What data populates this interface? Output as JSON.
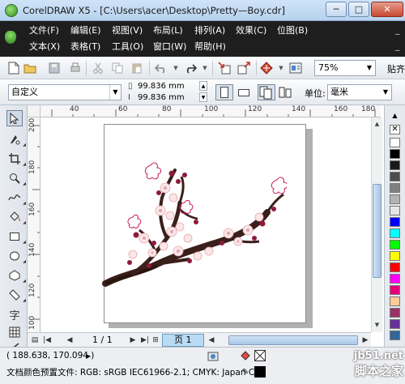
{
  "window": {
    "title": "CorelDRAW X5 - [C:\\Users\\acer\\Desktop\\Pretty—Boy.cdr]",
    "min_glyph": "─",
    "max_glyph": "□",
    "close_glyph": "✕"
  },
  "menubar": {
    "row1": [
      "文件(F)",
      "编辑(E)",
      "视图(V)",
      "布局(L)",
      "排列(A)",
      "效果(C)",
      "位图(B)"
    ],
    "row2": [
      "文本(X)",
      "表格(T)",
      "工具(O)",
      "窗口(W)",
      "帮助(H)"
    ],
    "row1_trailing": "_",
    "row2_trailing": "_"
  },
  "toolbar": {
    "zoom_value": "75%",
    "right_label": "贴齐",
    "icons": [
      "new-file-icon",
      "open-icon",
      "save-icon",
      "cut-icon",
      "copy-icon",
      "paste-icon",
      "undo-icon",
      "redo-icon",
      "import-icon",
      "export-icon",
      "application-launcher-icon",
      "welcome-screen-icon"
    ]
  },
  "property_bar": {
    "preset": "自定义",
    "width": "99.836 mm",
    "height": "99.836 mm",
    "unit_label": "单位:",
    "unit": "毫米"
  },
  "rulers": {
    "h_labels": [
      "40",
      "60",
      "80",
      "100",
      "120",
      "140",
      "160",
      "180"
    ],
    "v_labels": [
      "200",
      "180",
      "160",
      "140",
      "120",
      "100"
    ]
  },
  "page_nav": {
    "counter": "1 / 1",
    "tab_label": "页 1"
  },
  "status": {
    "coordinates": "( 188.638, 170.094 )",
    "color_profile": "文档颜色预置文件: RGB: sRGB IEC61966-2.1; CMYK: Japan C..."
  },
  "palette_colors": [
    "#ffffff",
    "#000000",
    "#1a1a1a",
    "#4d4d4d",
    "#808080",
    "#b3b3b3",
    "#e6e6e6",
    "#0000ff",
    "#00ffff",
    "#00ff00",
    "#ffff00",
    "#ff0000",
    "#ff00ff",
    "#e6007e",
    "#ffcc99",
    "#993366",
    "#663399",
    "#336699"
  ],
  "watermark": {
    "line1": "jb51.net",
    "line2": "脚本之家"
  }
}
